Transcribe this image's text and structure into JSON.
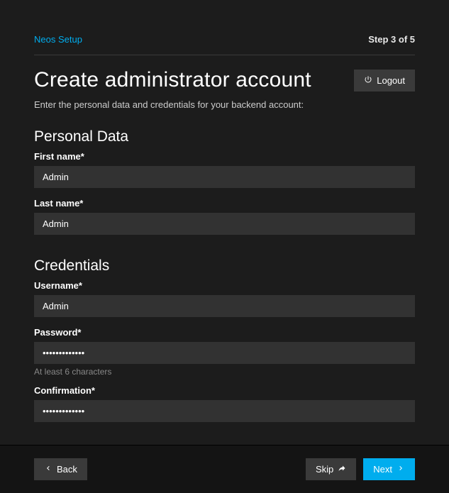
{
  "header": {
    "breadcrumb": "Neos Setup",
    "step_indicator": "Step 3 of 5"
  },
  "title": "Create administrator account",
  "logout_label": "Logout",
  "subtitle": "Enter the personal data and credentials for your backend account:",
  "sections": {
    "personal": {
      "heading": "Personal Data",
      "first_name_label": "First name*",
      "first_name_value": "Admin",
      "last_name_label": "Last name*",
      "last_name_value": "Admin"
    },
    "credentials": {
      "heading": "Credentials",
      "username_label": "Username*",
      "username_value": "Admin",
      "password_label": "Password*",
      "password_value": "•••••••••••••",
      "password_helper": "At least 6 characters",
      "confirmation_label": "Confirmation*",
      "confirmation_value": "•••••••••••••"
    }
  },
  "footer": {
    "back_label": "Back",
    "skip_label": "Skip",
    "next_label": "Next"
  }
}
